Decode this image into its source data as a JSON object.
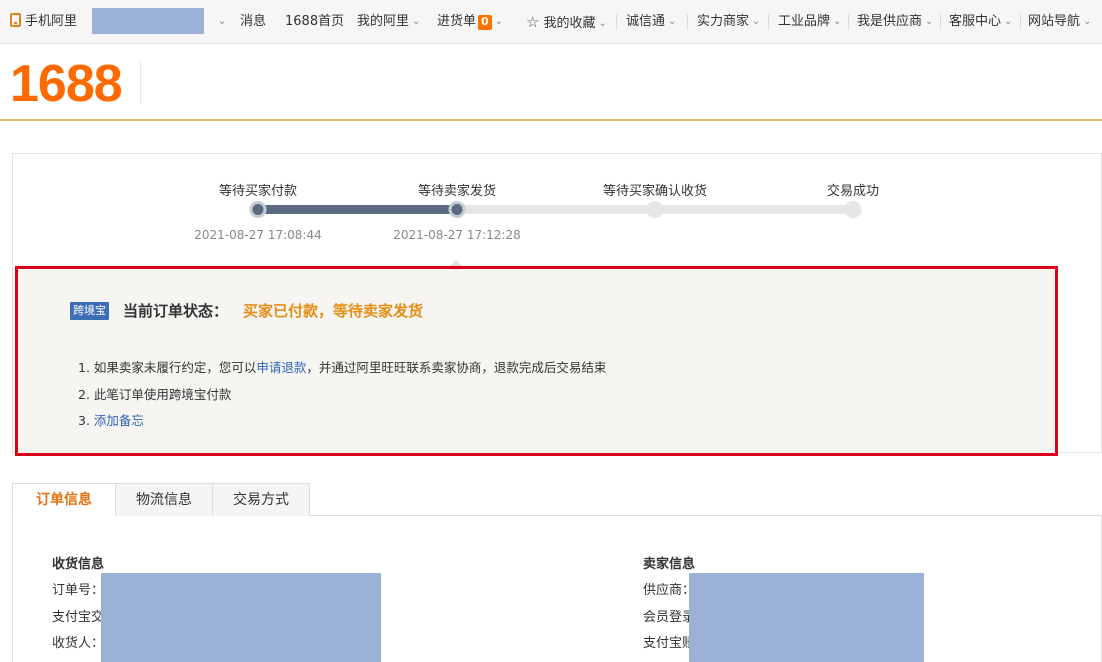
{
  "topnav": {
    "mobile": "手机阿里",
    "items": [
      {
        "label": "消息"
      },
      {
        "label": "1688首页"
      },
      {
        "label": "我的阿里"
      },
      {
        "label": "进货单",
        "count": "0"
      },
      {
        "label": "我的收藏"
      },
      {
        "label": "诚信通"
      },
      {
        "label": "实力商家"
      },
      {
        "label": "工业品牌"
      },
      {
        "label": "我是供应商"
      },
      {
        "label": "客服中心"
      },
      {
        "label": "网站导航"
      }
    ]
  },
  "logo": "1688",
  "progress": {
    "steps": [
      {
        "label": "等待买家付款",
        "time": "2021-08-27 17:08:44",
        "done": true
      },
      {
        "label": "等待卖家发货",
        "time": "2021-08-27 17:12:28",
        "done": true
      },
      {
        "label": "等待买家确认收货",
        "time": "",
        "done": false
      },
      {
        "label": "交易成功",
        "time": "",
        "done": false
      }
    ]
  },
  "status": {
    "badge": "跨境宝",
    "title": "当前订单状态：",
    "value": "买家已付款，等待卖家发货",
    "notes": {
      "n1_pre": "1. 如果卖家未履行约定，您可以",
      "n1_link": "申请退款",
      "n1_post": "，并通过阿里旺旺联系卖家协商，退款完成后交易结束",
      "n2": "2. 此笔订单使用跨境宝付款",
      "n3_pre": "3. ",
      "n3_link": "添加备忘"
    }
  },
  "tabs": [
    {
      "label": "订单信息",
      "active": true
    },
    {
      "label": "物流信息",
      "active": false
    },
    {
      "label": "交易方式",
      "active": false
    }
  ],
  "receiving": {
    "title": "收货信息",
    "fields": [
      "订单号：",
      "支付宝交",
      "收货人："
    ]
  },
  "seller": {
    "title": "卖家信息",
    "fields": [
      "供应商：",
      "会员登录",
      "支付宝账"
    ]
  },
  "colors": {
    "brand_orange": "#ff6a00",
    "highlight_red": "#d9001b",
    "status_orange": "#e58e16",
    "link_blue": "#2e63b8",
    "redaction": "#9bb2d6"
  }
}
